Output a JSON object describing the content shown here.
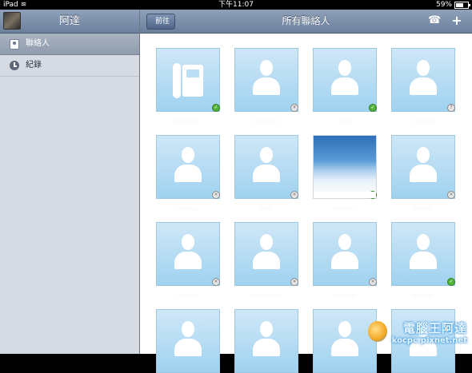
{
  "status_bar": {
    "device": "iPad",
    "time": "下午11:07",
    "battery": "59%"
  },
  "sidebar": {
    "title": "阿達",
    "items": [
      {
        "label": "聯絡人",
        "icon": "contact-card-icon",
        "selected": true
      },
      {
        "label": "紀錄",
        "icon": "clock-icon",
        "selected": false
      }
    ]
  },
  "main": {
    "back_label": "前往",
    "title": "所有聯絡人",
    "phone_icon": "phone-icon",
    "add_icon": "plus-icon"
  },
  "contacts": [
    {
      "name": "·········",
      "avatar": "phone-icon",
      "status": "online"
    },
    {
      "name": "·········",
      "avatar": "person-silhouette-icon",
      "status": "offline"
    },
    {
      "name": "····",
      "avatar": "person-silhouette-icon",
      "status": "online"
    },
    {
      "name": "·······",
      "avatar": "person-silhouette-icon",
      "status": "unknown"
    },
    {
      "name": "·······",
      "avatar": "person-silhouette-icon",
      "status": "offline"
    },
    {
      "name": "·····",
      "avatar": "person-silhouette-icon",
      "status": "offline"
    },
    {
      "name": "·········",
      "avatar": "sky-photo",
      "status": "online"
    },
    {
      "name": "······",
      "avatar": "person-silhouette-icon",
      "status": "offline"
    },
    {
      "name": "·······",
      "avatar": "person-silhouette-icon",
      "status": "offline"
    },
    {
      "name": "··········",
      "avatar": "person-silhouette-icon",
      "status": "offline"
    },
    {
      "name": "········",
      "avatar": "person-silhouette-icon",
      "status": "offline"
    },
    {
      "name": "·······",
      "avatar": "person-silhouette-icon",
      "status": "online"
    },
    {
      "name": "",
      "avatar": "person-silhouette-icon",
      "status": "none"
    },
    {
      "name": "",
      "avatar": "person-silhouette-icon",
      "status": "none"
    },
    {
      "name": "",
      "avatar": "person-silhouette-icon",
      "status": "none"
    },
    {
      "name": "",
      "avatar": "person-silhouette-icon",
      "status": "none"
    }
  ],
  "watermark": {
    "top": "電腦王阿達",
    "bottom": "kocpc.pixnet.net"
  },
  "colors": {
    "header": "#7b8ea9",
    "sidebar": "#d6dbe3",
    "tile": "#b5ddf4",
    "online": "#54b43a"
  }
}
